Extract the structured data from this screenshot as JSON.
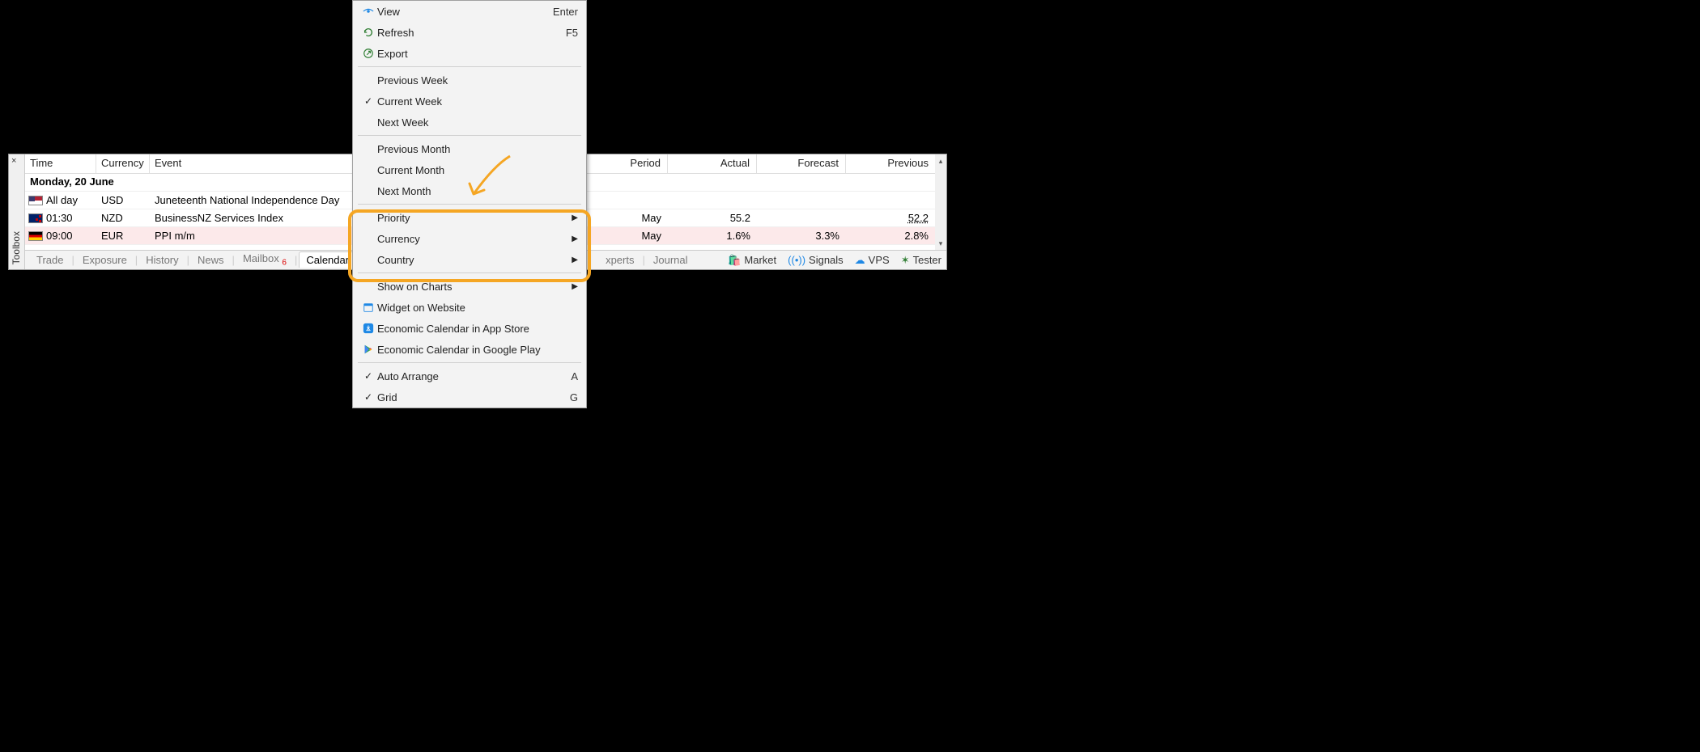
{
  "toolbox": {
    "label": "Toolbox",
    "close": "×"
  },
  "columns": {
    "time": "Time",
    "currency": "Currency",
    "event": "Event",
    "period": "Period",
    "actual": "Actual",
    "forecast": "Forecast",
    "previous": "Previous"
  },
  "group_date": "Monday, 20 June",
  "rows": [
    {
      "flag": "us",
      "time": "All day",
      "currency": "USD",
      "event": "Juneteenth National Independence Day",
      "period": "",
      "actual": "",
      "forecast": "",
      "previous": "",
      "highlight": false
    },
    {
      "flag": "nz",
      "time": "01:30",
      "currency": "NZD",
      "event": "BusinessNZ Services Index",
      "period": "May",
      "actual": "55.2",
      "forecast": "",
      "previous": "52.2",
      "highlight": false,
      "prev_underlined": true
    },
    {
      "flag": "de",
      "time": "09:00",
      "currency": "EUR",
      "event": "PPI m/m",
      "period": "May",
      "actual": "1.6%",
      "forecast": "3.3%",
      "previous": "2.8%",
      "highlight": true
    }
  ],
  "tabs": {
    "trade": "Trade",
    "exposure": "Exposure",
    "history": "History",
    "news": "News",
    "mailbox": "Mailbox",
    "mailbox_count": "6",
    "calendar": "Calendar",
    "experts": "xperts",
    "journal": "Journal"
  },
  "tabbar_right": {
    "market": "Market",
    "signals": "Signals",
    "vps": "VPS",
    "tester": "Tester"
  },
  "menu": {
    "view": "View",
    "view_shortcut": "Enter",
    "refresh": "Refresh",
    "refresh_shortcut": "F5",
    "export": "Export",
    "prev_week": "Previous Week",
    "cur_week": "Current Week",
    "next_week": "Next Week",
    "prev_month": "Previous Month",
    "cur_month": "Current Month",
    "next_month": "Next Month",
    "priority": "Priority",
    "currency": "Currency",
    "country": "Country",
    "show_charts": "Show on Charts",
    "widget": "Widget on Website",
    "appstore": "Economic Calendar in App Store",
    "gplay": "Economic Calendar in Google Play",
    "auto_arrange": "Auto Arrange",
    "auto_arrange_shortcut": "A",
    "grid": "Grid",
    "grid_shortcut": "G"
  },
  "colors": {
    "highlight_orange": "#f5a623",
    "row_pink": "#fce9ea"
  }
}
